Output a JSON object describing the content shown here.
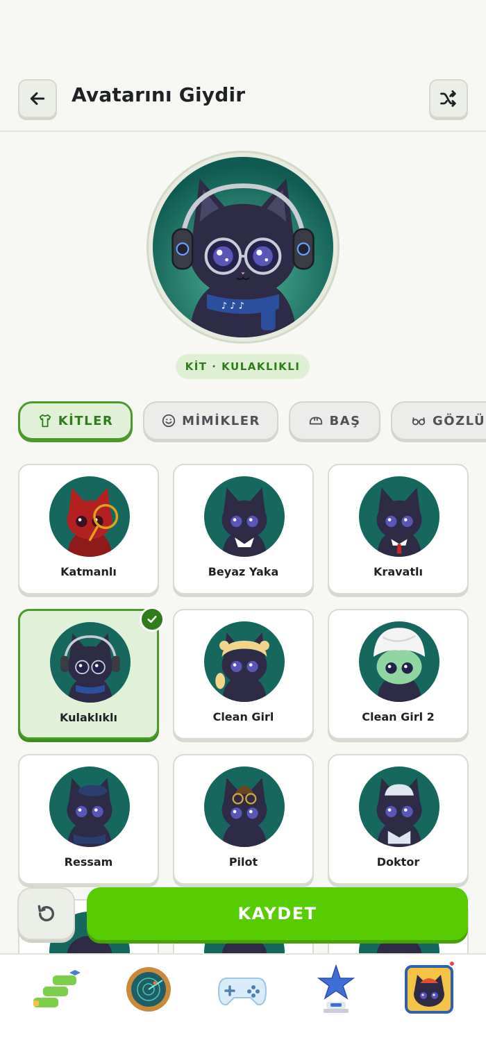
{
  "header": {
    "title": "Avatarını Giydir",
    "back_icon": "arrow-left-icon",
    "shuffle_icon": "shuffle-icon"
  },
  "preview": {
    "label": "KİT · KULAKLIKLI"
  },
  "tabs": [
    {
      "label": "KİTLER",
      "icon": "shirt-icon",
      "active": true
    },
    {
      "label": "MİMİKLER",
      "icon": "smiley-icon",
      "active": false
    },
    {
      "label": "BAŞ",
      "icon": "helmet-icon",
      "active": false
    },
    {
      "label": "GÖZLÜ",
      "icon": "glasses-icon",
      "active": false
    }
  ],
  "kits": [
    {
      "label": "Katmanlı"
    },
    {
      "label": "Beyaz Yaka"
    },
    {
      "label": "Kravatlı"
    },
    {
      "label": "Kulaklıklı",
      "selected": true
    },
    {
      "label": "Clean Girl"
    },
    {
      "label": "Clean Girl 2"
    },
    {
      "label": "Ressam"
    },
    {
      "label": "Pilot"
    },
    {
      "label": "Doktor"
    }
  ],
  "actions": {
    "save_label": "KAYDET",
    "reset_icon": "undo-icon"
  },
  "bottom_nav": [
    {
      "name": "learn-path-icon"
    },
    {
      "name": "radar-icon"
    },
    {
      "name": "gamepad-icon"
    },
    {
      "name": "trophy-star-icon"
    },
    {
      "name": "avatar-profile-icon",
      "badge": true
    }
  ],
  "colors": {
    "accent": "#58cc02",
    "accent_dark": "#2f7d1a",
    "selected_bg": "#e1f1d7",
    "cat_body": "#2d2b45",
    "thumb_bg": "#16685f"
  }
}
